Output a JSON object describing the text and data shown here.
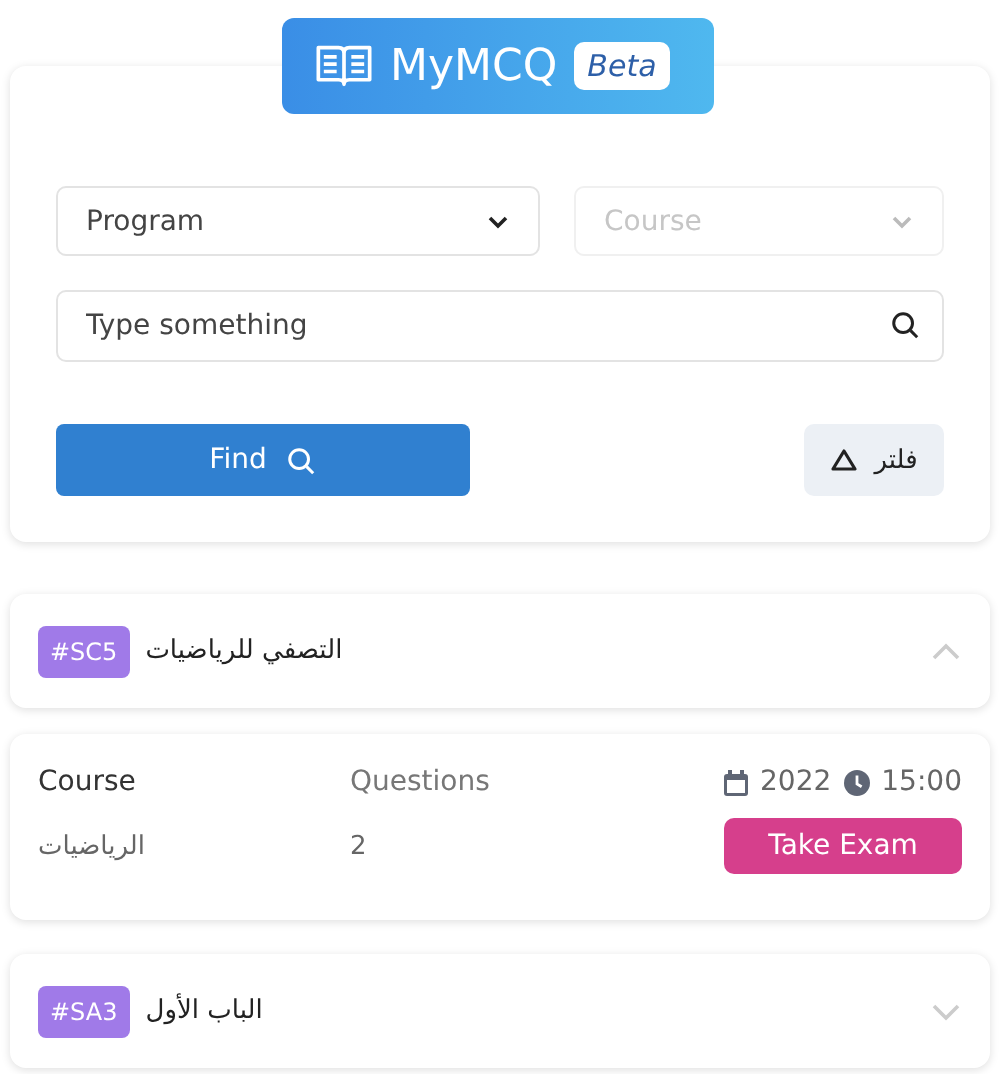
{
  "logo": {
    "name": "MyMCQ",
    "badge": "Beta"
  },
  "filters": {
    "selects": [
      {
        "placeholder": "Program",
        "disabled": false
      },
      {
        "placeholder": "Course",
        "disabled": true
      }
    ],
    "search": {
      "placeholder": "Type something"
    },
    "find_button": "Find",
    "filter_button": {
      "label": "فلتر",
      "expanded": true
    }
  },
  "exams": [
    {
      "code": "#SC5",
      "title": "التصفي للرياضيات",
      "expanded": true,
      "details": {
        "course_label": "Course",
        "questions_label": "Questions",
        "date": "2022",
        "time": "15:00",
        "course": "الرياضيات",
        "questions": "2",
        "button": "Take Exam"
      }
    },
    {
      "code": "#SA3",
      "title": "الباب الأول",
      "expanded": false
    }
  ]
}
